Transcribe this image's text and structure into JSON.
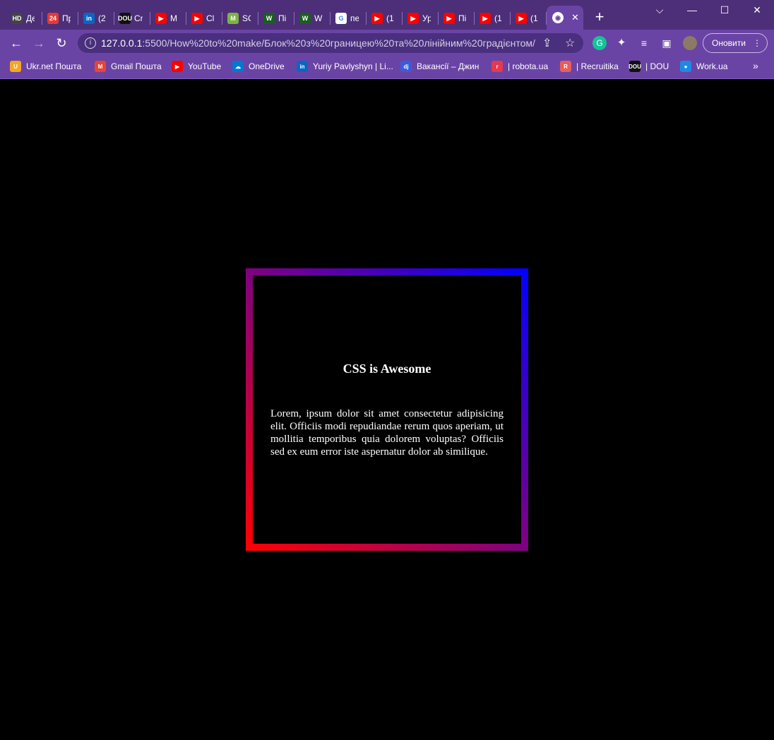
{
  "browser": {
    "tabs": [
      {
        "icon": "hd-icon",
        "favicon_text": "HD",
        "favicon_color": "#444444",
        "label": "Дє"
      },
      {
        "icon": "24-icon",
        "favicon_text": "24",
        "favicon_color": "#e53935",
        "label": "Пр"
      },
      {
        "icon": "linkedin-icon",
        "favicon_text": "in",
        "favicon_color": "#0a66c2",
        "label": "(2"
      },
      {
        "icon": "dou-icon",
        "favicon_text": "DOU",
        "favicon_color": "#111111",
        "label": "Cr"
      },
      {
        "icon": "youtube-icon",
        "favicon_text": "▶",
        "favicon_color": "#ff0000",
        "label": "M"
      },
      {
        "icon": "youtube-icon",
        "favicon_text": "▶",
        "favicon_color": "#ff0000",
        "label": "Cl"
      },
      {
        "icon": "m-icon",
        "favicon_text": "M",
        "favicon_color": "#7cb342",
        "label": "SC"
      },
      {
        "icon": "w-icon",
        "favicon_text": "W",
        "favicon_color": "#1b5e20",
        "label": "Пі"
      },
      {
        "icon": "w-icon",
        "favicon_text": "W",
        "favicon_color": "#1b5e20",
        "label": "W"
      },
      {
        "icon": "google-icon",
        "favicon_text": "G",
        "favicon_color": "#ffffff",
        "label": "пе"
      },
      {
        "icon": "youtube-icon",
        "favicon_text": "▶",
        "favicon_color": "#ff0000",
        "label": "(1"
      },
      {
        "icon": "youtube-icon",
        "favicon_text": "▶",
        "favicon_color": "#ff0000",
        "label": "Ур"
      },
      {
        "icon": "youtube-icon",
        "favicon_text": "▶",
        "favicon_color": "#ff0000",
        "label": "Пі"
      },
      {
        "icon": "youtube-icon",
        "favicon_text": "▶",
        "favicon_color": "#ff0000",
        "label": "(1"
      },
      {
        "icon": "youtube-icon",
        "favicon_text": "▶",
        "favicon_color": "#ff0000",
        "label": "(1"
      }
    ],
    "active_tab_close": "✕",
    "new_tab": "+",
    "window_controls": {
      "menu": "⌵",
      "minimize": "—",
      "maximize": "☐",
      "close": "✕"
    },
    "nav": {
      "back": "←",
      "forward": "→",
      "reload": "↻"
    },
    "url_host": "127.0.0.1",
    "url_rest": ":5500/How%20to%20make/Блок%20з%20границею%20та%20лінійним%20градієнтом/",
    "update_button": "Оновити",
    "bookmarks": [
      {
        "icon": "ukrnet-icon",
        "favicon_text": "U",
        "color": "#f5a623",
        "label": "Ukr.net Пошта"
      },
      {
        "icon": "gmail-icon",
        "favicon_text": "M",
        "color": "#ea4335",
        "label": "Gmail Пошта"
      },
      {
        "icon": "youtube-icon",
        "favicon_text": "▶",
        "color": "#ff0000",
        "label": "YouTube"
      },
      {
        "icon": "onedrive-icon",
        "favicon_text": "☁",
        "color": "#0078d4",
        "label": "OneDrive"
      },
      {
        "icon": "linkedin-icon",
        "favicon_text": "in",
        "color": "#0a66c2",
        "label": "Yuriy Pavlyshyn | Li..."
      },
      {
        "icon": "djinni-icon",
        "favicon_text": "dj",
        "color": "#3b5bdb",
        "label": "Вакансії – Джин"
      },
      {
        "icon": "robota-icon",
        "favicon_text": "r",
        "color": "#e53950",
        "label": "| robota.ua"
      },
      {
        "icon": "recruitika-icon",
        "favicon_text": "R",
        "color": "#e85d5d",
        "label": "| Recruitika"
      },
      {
        "icon": "dou-icon",
        "favicon_text": "DOU",
        "color": "#111111",
        "label": "| DOU"
      },
      {
        "icon": "workua-icon",
        "favicon_text": "●",
        "color": "#1e88e5",
        "label": "Work.ua"
      }
    ],
    "bookmarks_more": "»"
  },
  "content": {
    "title": "CSS is Awesome",
    "text": "Lorem, ipsum dolor sit amet consectetur adipisicing elit. Officiis modi repudiandae rerum quos aperiam, ut mollitia temporibus quia dolorem voluptas? Officiis sed ex eum error iste aspernatur dolor ab similique.",
    "gradient_colors": [
      "#ff0000",
      "#0000ff"
    ]
  }
}
